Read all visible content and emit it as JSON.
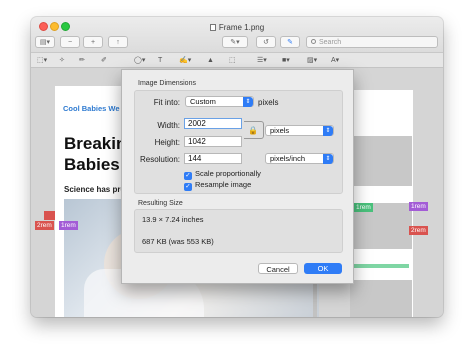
{
  "window": {
    "title": "Frame 1.png"
  },
  "toolbar": {
    "search_placeholder": "Search"
  },
  "document": {
    "site_title": "Cool Babies We",
    "headline": "Breakin\nBabies",
    "subline": "Science has pro",
    "measure_labels": {
      "green_left": "1rem",
      "green_right": "1rem",
      "purple_left": "1rem",
      "purple_right": "1rem",
      "red_left": "2rem",
      "red_right": "2rem"
    }
  },
  "dialog": {
    "section_title": "Image Dimensions",
    "fit_into_label": "Fit into:",
    "fit_into_value": "Custom",
    "fit_into_unit": "pixels",
    "width_label": "Width:",
    "width_value": "2002",
    "height_label": "Height:",
    "height_value": "1042",
    "dimension_unit": "pixels",
    "resolution_label": "Resolution:",
    "resolution_value": "144",
    "resolution_unit": "pixels/inch",
    "scale_label": "Scale proportionally",
    "resample_label": "Resample image",
    "resulting_title": "Resulting Size",
    "resulting_dimensions": "13.9 × 7.24 inches",
    "resulting_filesize": "687 KB (was 553 KB)",
    "cancel_label": "Cancel",
    "ok_label": "OK"
  }
}
